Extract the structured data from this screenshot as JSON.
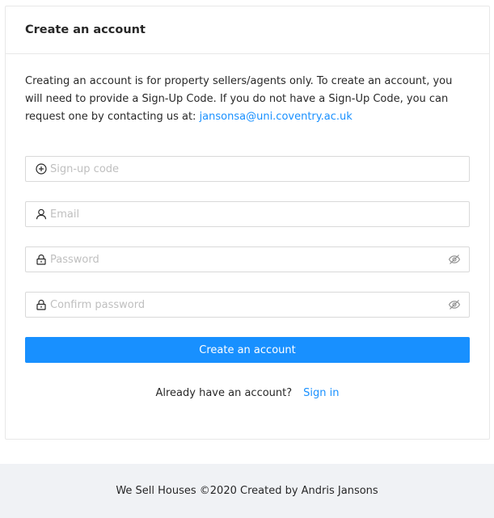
{
  "card": {
    "title": "Create an account",
    "intro_text": "Creating an account is for property sellers/agents only. To create an account, you will need to provide a Sign-Up Code. If you do not have a Sign-Up Code, you can request one by contacting us at: ",
    "contact_email": "jansonsa@uni.coventry.ac.uk"
  },
  "form": {
    "signup_code": {
      "placeholder": "Sign-up code",
      "value": "",
      "icon": "plus-circle-icon"
    },
    "email": {
      "placeholder": "Email",
      "value": "",
      "icon": "user-icon"
    },
    "password": {
      "placeholder": "Password",
      "value": "",
      "icon": "lock-icon",
      "toggle_icon": "eye-invisible-icon"
    },
    "confirm_password": {
      "placeholder": "Confirm password",
      "value": "",
      "icon": "lock-icon",
      "toggle_icon": "eye-invisible-icon"
    },
    "submit_label": "Create an account"
  },
  "signin": {
    "prompt": "Already have an account?",
    "link_label": "Sign in"
  },
  "footer": {
    "text": "We Sell Houses ©2020 Created by Andris Jansons"
  },
  "colors": {
    "primary": "#1890ff",
    "border": "#d9d9d9",
    "footer_bg": "#f0f2f5"
  }
}
